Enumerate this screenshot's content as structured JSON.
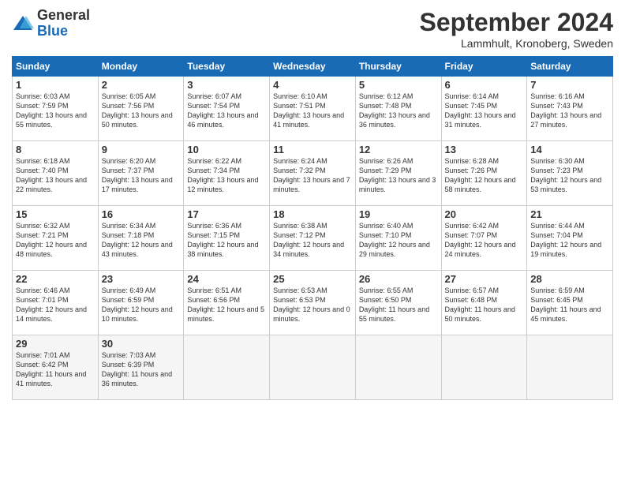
{
  "logo": {
    "general": "General",
    "blue": "Blue"
  },
  "header": {
    "month": "September 2024",
    "location": "Lammhult, Kronoberg, Sweden"
  },
  "weekdays": [
    "Sunday",
    "Monday",
    "Tuesday",
    "Wednesday",
    "Thursday",
    "Friday",
    "Saturday"
  ],
  "weeks": [
    [
      {
        "day": "1",
        "rise": "6:03 AM",
        "set": "7:59 PM",
        "daylight": "13 hours and 55 minutes."
      },
      {
        "day": "2",
        "rise": "6:05 AM",
        "set": "7:56 PM",
        "daylight": "13 hours and 50 minutes."
      },
      {
        "day": "3",
        "rise": "6:07 AM",
        "set": "7:54 PM",
        "daylight": "13 hours and 46 minutes."
      },
      {
        "day": "4",
        "rise": "6:10 AM",
        "set": "7:51 PM",
        "daylight": "13 hours and 41 minutes."
      },
      {
        "day": "5",
        "rise": "6:12 AM",
        "set": "7:48 PM",
        "daylight": "13 hours and 36 minutes."
      },
      {
        "day": "6",
        "rise": "6:14 AM",
        "set": "7:45 PM",
        "daylight": "13 hours and 31 minutes."
      },
      {
        "day": "7",
        "rise": "6:16 AM",
        "set": "7:43 PM",
        "daylight": "13 hours and 27 minutes."
      }
    ],
    [
      {
        "day": "8",
        "rise": "6:18 AM",
        "set": "7:40 PM",
        "daylight": "13 hours and 22 minutes."
      },
      {
        "day": "9",
        "rise": "6:20 AM",
        "set": "7:37 PM",
        "daylight": "13 hours and 17 minutes."
      },
      {
        "day": "10",
        "rise": "6:22 AM",
        "set": "7:34 PM",
        "daylight": "13 hours and 12 minutes."
      },
      {
        "day": "11",
        "rise": "6:24 AM",
        "set": "7:32 PM",
        "daylight": "13 hours and 7 minutes."
      },
      {
        "day": "12",
        "rise": "6:26 AM",
        "set": "7:29 PM",
        "daylight": "13 hours and 3 minutes."
      },
      {
        "day": "13",
        "rise": "6:28 AM",
        "set": "7:26 PM",
        "daylight": "12 hours and 58 minutes."
      },
      {
        "day": "14",
        "rise": "6:30 AM",
        "set": "7:23 PM",
        "daylight": "12 hours and 53 minutes."
      }
    ],
    [
      {
        "day": "15",
        "rise": "6:32 AM",
        "set": "7:21 PM",
        "daylight": "12 hours and 48 minutes."
      },
      {
        "day": "16",
        "rise": "6:34 AM",
        "set": "7:18 PM",
        "daylight": "12 hours and 43 minutes."
      },
      {
        "day": "17",
        "rise": "6:36 AM",
        "set": "7:15 PM",
        "daylight": "12 hours and 38 minutes."
      },
      {
        "day": "18",
        "rise": "6:38 AM",
        "set": "7:12 PM",
        "daylight": "12 hours and 34 minutes."
      },
      {
        "day": "19",
        "rise": "6:40 AM",
        "set": "7:10 PM",
        "daylight": "12 hours and 29 minutes."
      },
      {
        "day": "20",
        "rise": "6:42 AM",
        "set": "7:07 PM",
        "daylight": "12 hours and 24 minutes."
      },
      {
        "day": "21",
        "rise": "6:44 AM",
        "set": "7:04 PM",
        "daylight": "12 hours and 19 minutes."
      }
    ],
    [
      {
        "day": "22",
        "rise": "6:46 AM",
        "set": "7:01 PM",
        "daylight": "12 hours and 14 minutes."
      },
      {
        "day": "23",
        "rise": "6:49 AM",
        "set": "6:59 PM",
        "daylight": "12 hours and 10 minutes."
      },
      {
        "day": "24",
        "rise": "6:51 AM",
        "set": "6:56 PM",
        "daylight": "12 hours and 5 minutes."
      },
      {
        "day": "25",
        "rise": "6:53 AM",
        "set": "6:53 PM",
        "daylight": "12 hours and 0 minutes."
      },
      {
        "day": "26",
        "rise": "6:55 AM",
        "set": "6:50 PM",
        "daylight": "11 hours and 55 minutes."
      },
      {
        "day": "27",
        "rise": "6:57 AM",
        "set": "6:48 PM",
        "daylight": "11 hours and 50 minutes."
      },
      {
        "day": "28",
        "rise": "6:59 AM",
        "set": "6:45 PM",
        "daylight": "11 hours and 45 minutes."
      }
    ],
    [
      {
        "day": "29",
        "rise": "7:01 AM",
        "set": "6:42 PM",
        "daylight": "11 hours and 41 minutes."
      },
      {
        "day": "30",
        "rise": "7:03 AM",
        "set": "6:39 PM",
        "daylight": "11 hours and 36 minutes."
      },
      null,
      null,
      null,
      null,
      null
    ]
  ]
}
